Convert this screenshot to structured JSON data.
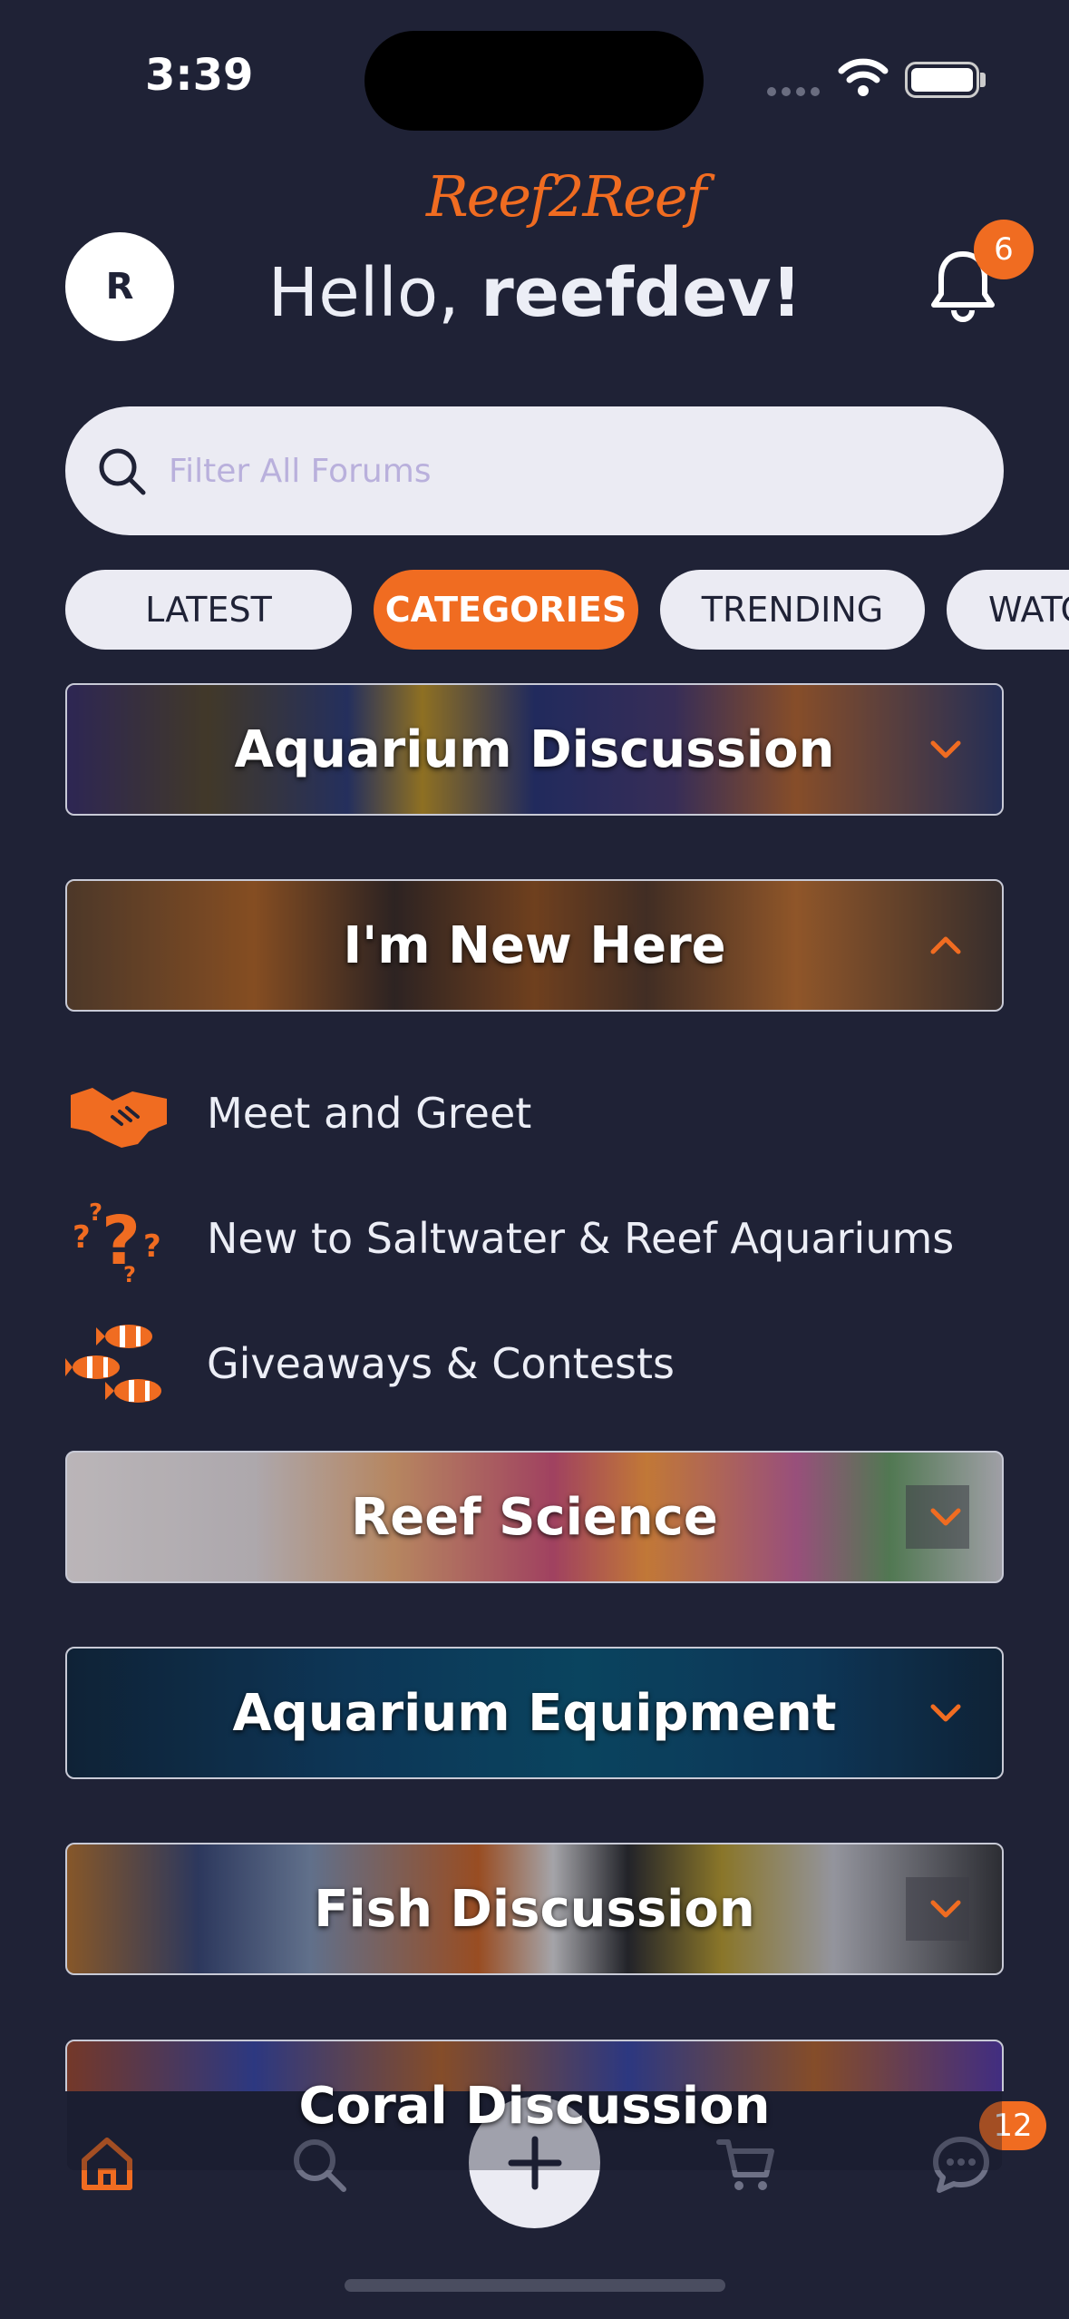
{
  "status_bar": {
    "time": "3:39"
  },
  "header": {
    "logo": "Reef2Reef",
    "avatar_initial": "R",
    "greeting_prefix": "Hello, ",
    "username": "reefdev!",
    "notification_count": "6"
  },
  "search": {
    "placeholder": "Filter All Forums"
  },
  "tabs": [
    {
      "label": "LATEST"
    },
    {
      "label": "CATEGORIES",
      "active": true
    },
    {
      "label": "TRENDING"
    },
    {
      "label": "WATCHED"
    }
  ],
  "categories": [
    {
      "title": "Aquarium Discussion",
      "expanded": false
    },
    {
      "title": "I'm New Here",
      "expanded": true
    },
    {
      "title": "Reef Science",
      "expanded": false
    },
    {
      "title": "Aquarium Equipment",
      "expanded": false
    },
    {
      "title": "Fish Discussion",
      "expanded": false
    },
    {
      "title": "Coral Discussion",
      "expanded": false
    }
  ],
  "subforums": [
    {
      "label": "Meet and Greet",
      "icon": "handshake-icon"
    },
    {
      "label": "New to Saltwater & Reef Aquariums",
      "icon": "question-marks-icon"
    },
    {
      "label": "Giveaways & Contests",
      "icon": "clownfish-icon"
    }
  ],
  "bottom_nav": {
    "items": [
      "home-icon",
      "search-icon",
      "plus-icon",
      "cart-icon",
      "chat-icon"
    ],
    "active": "home-icon",
    "chat_badge": "12"
  },
  "colors": {
    "background": "#1f2236",
    "accent": "#f06c21",
    "pill": "#ebebf3"
  }
}
